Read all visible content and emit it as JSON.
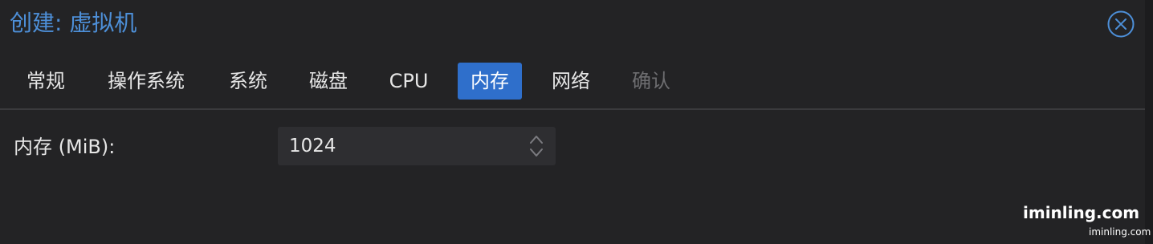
{
  "window": {
    "title": "创建: 虚拟机",
    "close_icon": "circle-x-icon"
  },
  "tabs": [
    {
      "label": "常规",
      "state": "normal"
    },
    {
      "label": "操作系统",
      "state": "normal"
    },
    {
      "label": "系统",
      "state": "normal"
    },
    {
      "label": "磁盘",
      "state": "normal"
    },
    {
      "label": "CPU",
      "state": "normal"
    },
    {
      "label": "内存",
      "state": "active"
    },
    {
      "label": "网络",
      "state": "normal"
    },
    {
      "label": "确认",
      "state": "disabled"
    }
  ],
  "memory": {
    "label": "内存 (MiB):",
    "value": "1024",
    "spinner_icon": "up-down-chevron-icon"
  },
  "watermark": {
    "large": "iminling.com",
    "small": "iminling.com"
  },
  "colors": {
    "accent": "#2f6fcb",
    "title": "#4d8fd8",
    "background": "#232325",
    "disabled_text": "#6d6d70"
  }
}
